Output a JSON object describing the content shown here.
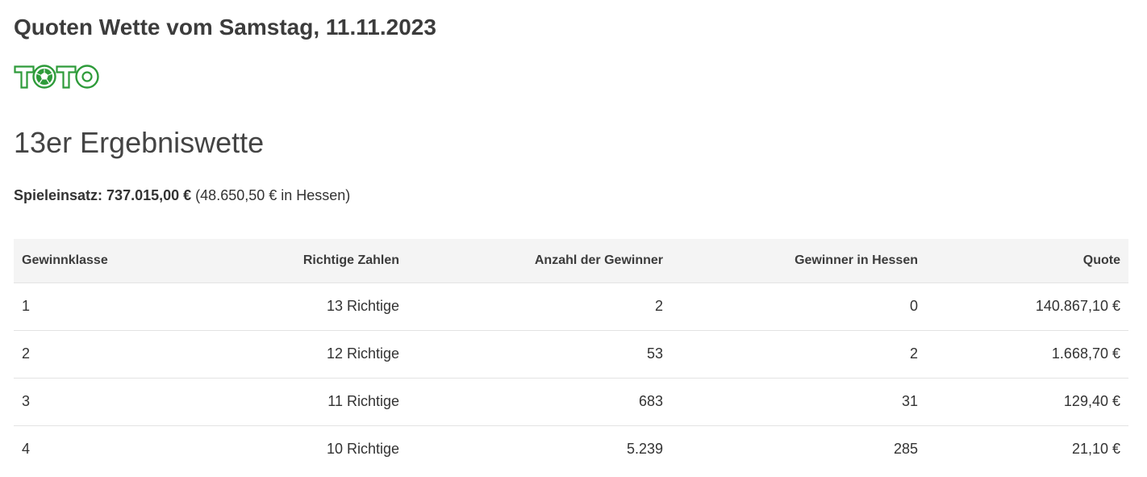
{
  "header": {
    "title": "Quoten Wette vom Samstag, 11.11.2023",
    "logo_text": "TOTO",
    "logo_color": "#2e9b3a"
  },
  "section": {
    "title": "13er Ergebniswette"
  },
  "stake": {
    "label": "Spieleinsatz:",
    "amount": "737.015,00  €",
    "hessen": "(48.650,50  € in Hessen)"
  },
  "table": {
    "columns": [
      "Gewinnklasse",
      "Richtige Zahlen",
      "Anzahl der Gewinner",
      "Gewinner in Hessen",
      "Quote"
    ],
    "rows": [
      {
        "klasse": "1",
        "richtige": "13 Richtige",
        "anzahl": "2",
        "hessen": "0",
        "quote": "140.867,10  €"
      },
      {
        "klasse": "2",
        "richtige": "12 Richtige",
        "anzahl": "53",
        "hessen": "2",
        "quote": "1.668,70  €"
      },
      {
        "klasse": "3",
        "richtige": "11 Richtige",
        "anzahl": "683",
        "hessen": "31",
        "quote": "129,40  €"
      },
      {
        "klasse": "4",
        "richtige": "10 Richtige",
        "anzahl": "5.239",
        "hessen": "285",
        "quote": "21,10  €"
      }
    ]
  }
}
